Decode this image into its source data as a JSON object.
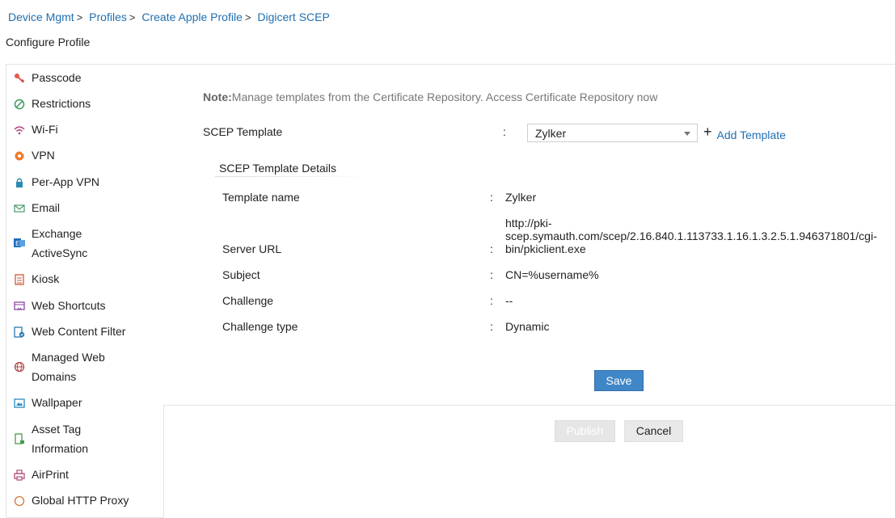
{
  "breadcrumb": {
    "items": [
      "Device Mgmt",
      "Profiles",
      "Create Apple Profile",
      "Digicert SCEP"
    ],
    "separator": ">"
  },
  "page_title": "Configure Profile",
  "sidebar": {
    "items": [
      {
        "label": "Passcode",
        "icon": "key-icon"
      },
      {
        "label": "Restrictions",
        "icon": "restrictions-icon"
      },
      {
        "label": "Wi-Fi",
        "icon": "wifi-icon"
      },
      {
        "label": "VPN",
        "icon": "vpn-icon"
      },
      {
        "label": "Per-App VPN",
        "icon": "lock-icon"
      },
      {
        "label": "Email",
        "icon": "envelope-icon"
      },
      {
        "label": "Exchange ActiveSync",
        "label_line1": "Exchange",
        "label_line2": "ActiveSync",
        "icon": "exchange-icon"
      },
      {
        "label": "Kiosk",
        "icon": "kiosk-icon"
      },
      {
        "label": "Web Shortcuts",
        "icon": "web-shortcut-icon"
      },
      {
        "label": "Web Content Filter",
        "icon": "web-filter-icon"
      },
      {
        "label": "Managed Web Domains",
        "label_line1": "Managed Web",
        "label_line2": "Domains",
        "icon": "globe-icon"
      },
      {
        "label": "Wallpaper",
        "icon": "image-icon"
      },
      {
        "label": "Asset Tag Information",
        "label_line1": "Asset Tag",
        "label_line2": "Information",
        "icon": "asset-tag-icon"
      },
      {
        "label": "AirPrint",
        "icon": "printer-icon"
      },
      {
        "label": "Global HTTP Proxy",
        "icon": "proxy-icon"
      }
    ]
  },
  "note": {
    "prefix": "Note:",
    "text": "Manage templates from the Certificate Repository. Access Certificate Repository now"
  },
  "scep_template": {
    "label": "SCEP Template",
    "colon": ":",
    "selected": "Zylker",
    "add_label": "Add Template",
    "add_icon": "+"
  },
  "details": {
    "title": "SCEP Template Details",
    "rows": [
      {
        "label": "Template name",
        "value": "Zylker"
      },
      {
        "label": "Server URL",
        "value": "http://pki-scep.symauth.com/scep/2.16.840.1.113733.1.16.1.3.2.5.1.946371801/cgi-bin/pkiclient.exe",
        "value_line1": "http://pki-",
        "value_line2": "scep.symauth.com/scep/2.16.840.1.113733.1.16.1.3.2.5.1.946371801/cgi-",
        "value_line3": "bin/pkiclient.exe"
      },
      {
        "label": "Subject",
        "value": "CN=%username%"
      },
      {
        "label": "Challenge",
        "value": "--"
      },
      {
        "label": "Challenge type",
        "value": "Dynamic"
      }
    ]
  },
  "buttons": {
    "save": "Save",
    "publish": "Publish",
    "cancel": "Cancel"
  },
  "colors": {
    "link": "#1f6fb2",
    "primary_button": "#3f87c7",
    "disabled_button": "#e6e6e6"
  }
}
